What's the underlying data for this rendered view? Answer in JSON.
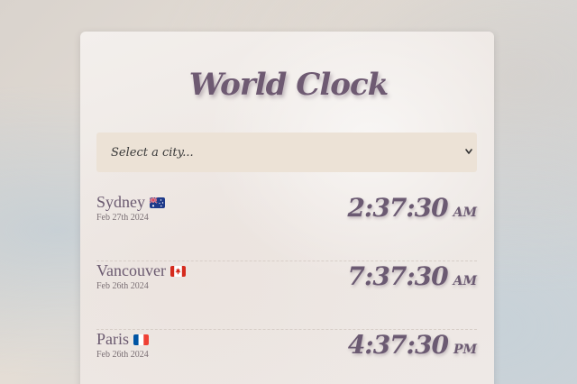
{
  "app": {
    "title": "World Clock"
  },
  "select": {
    "placeholder": "Select a city..."
  },
  "cities": [
    {
      "name": "Sydney",
      "date": "Feb 27th 2024",
      "time": "2:37:30",
      "ampm": "AM",
      "flag": "australia-flag"
    },
    {
      "name": "Vancouver",
      "date": "Feb 26th 2024",
      "time": "7:37:30",
      "ampm": "AM",
      "flag": "canada-flag"
    },
    {
      "name": "Paris",
      "date": "Feb 26th 2024",
      "time": "4:37:30",
      "ampm": "PM",
      "flag": "france-flag"
    }
  ],
  "colors": {
    "title": "#6e5a72",
    "select_bg": "#ece2d6",
    "card_bg": "#f1ece9"
  }
}
